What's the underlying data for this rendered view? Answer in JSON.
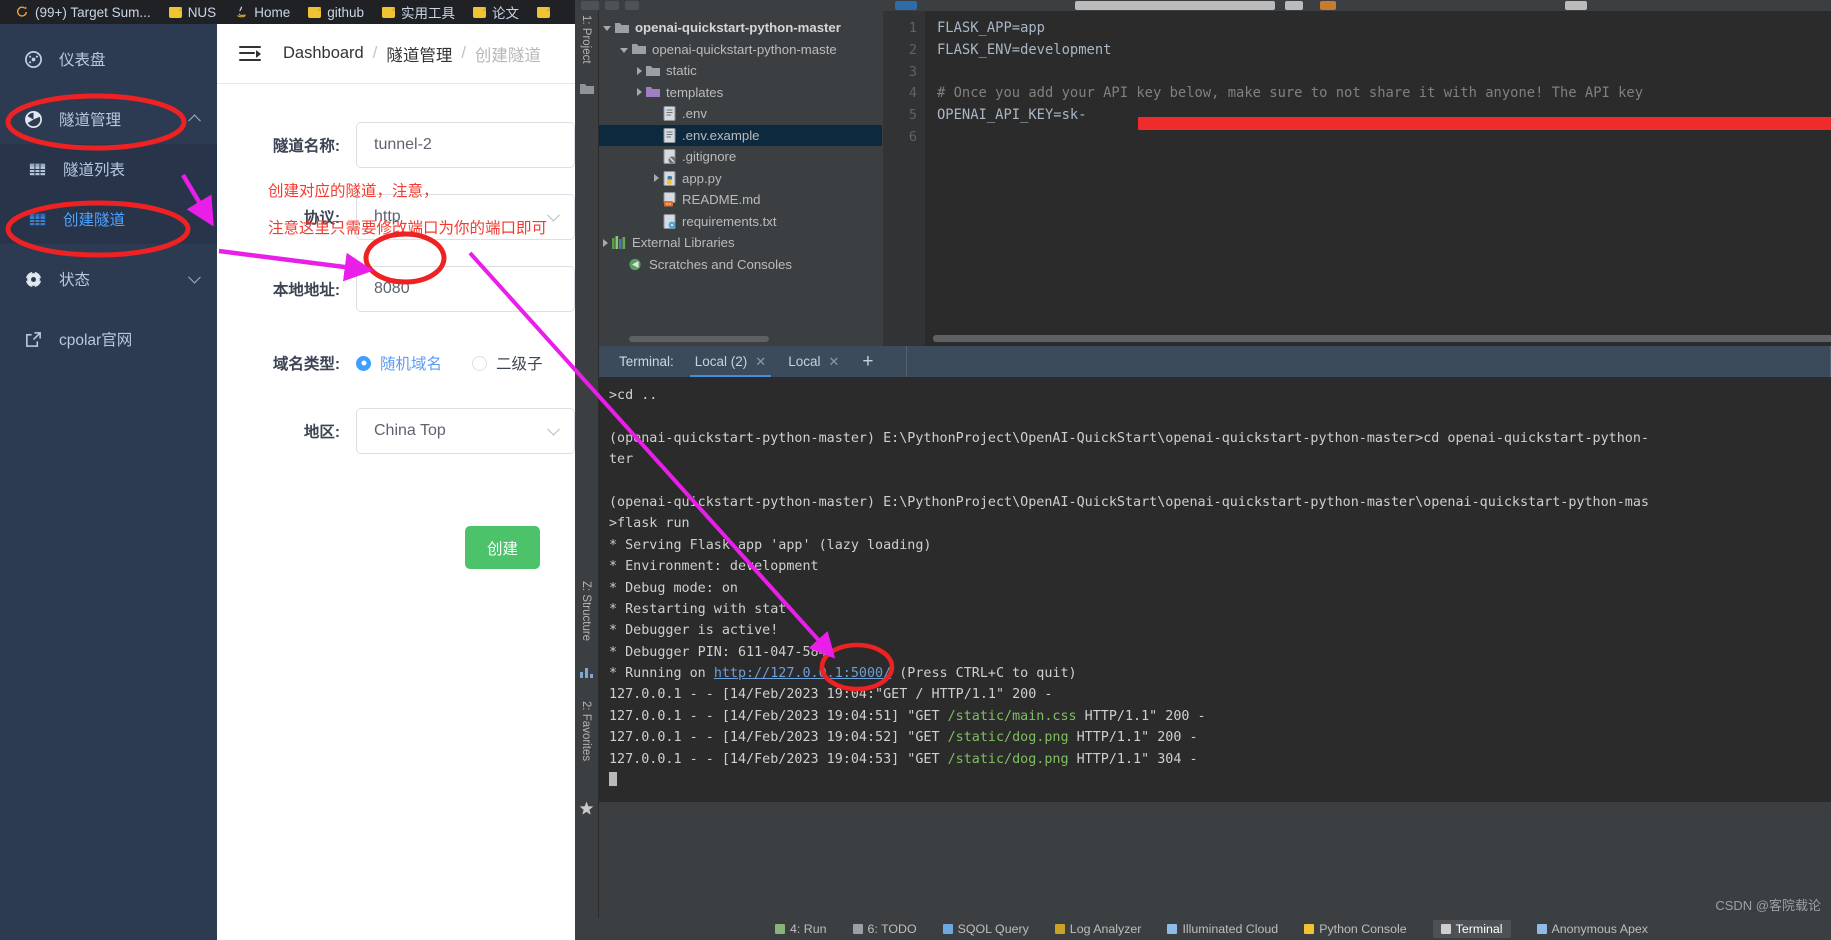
{
  "browser": {
    "bookmarks": [
      {
        "label": "(99+) Target Sum...",
        "icon": "spiral-icon"
      },
      {
        "label": "NUS",
        "icon": "folder-icon"
      },
      {
        "label": "Home",
        "icon": "java-icon"
      },
      {
        "label": "github",
        "icon": "folder-icon"
      },
      {
        "label": "实用工具",
        "icon": "folder-icon"
      },
      {
        "label": "论文",
        "icon": "folder-icon"
      },
      {
        "label": "",
        "icon": "folder-icon"
      }
    ]
  },
  "cpolar": {
    "sidebar": {
      "dashboard": {
        "label": "仪表盘",
        "icon": "gauge-icon"
      },
      "tunnel_mgmt": {
        "label": "隧道管理",
        "icon": "tunnel-icon"
      },
      "tunnel_list": {
        "label": "隧道列表",
        "icon": "grid-icon"
      },
      "create_tunnel": {
        "label": "创建隧道",
        "icon": "grid-blue-icon"
      },
      "status": {
        "label": "状态",
        "icon": "status-icon"
      },
      "website": {
        "label": "cpolar官网",
        "icon": "external-link-icon"
      }
    },
    "breadcrumb": {
      "root": "Dashboard",
      "sep": "/",
      "level1": "隧道管理",
      "level2": "创建隧道"
    },
    "form": {
      "tunnel_name": {
        "label": "隧道名称:",
        "value": "tunnel-2"
      },
      "protocol": {
        "label": "协议:",
        "value": "http"
      },
      "local_addr": {
        "label": "本地地址:",
        "value": "8080"
      },
      "domain_type": {
        "label": "域名类型:",
        "selected": "随机域名",
        "options": [
          "随机域名",
          "二级子"
        ]
      },
      "region": {
        "label": "地区:",
        "value": "China Top"
      },
      "submit": "创建"
    },
    "annotations": {
      "line1": "创建对应的隧道，注意，",
      "line2": "注意这里只需要修改端口为你的端口即可"
    }
  },
  "ide": {
    "left_strips": [
      "1: Project",
      "Z: Structure",
      "2: Favorites"
    ],
    "project_tree": [
      {
        "name": "openai-quickstart-python-master",
        "depth": 0,
        "icon": "folder-icon",
        "arrow": "open",
        "bold": true
      },
      {
        "name": "openai-quickstart-python-maste",
        "depth": 1,
        "icon": "folder-icon",
        "arrow": "open",
        "bold": false
      },
      {
        "name": "static",
        "depth": 2,
        "icon": "folder-icon",
        "arrow": "closed",
        "bold": false
      },
      {
        "name": "templates",
        "depth": 2,
        "icon": "folder-purple-icon",
        "arrow": "closed",
        "bold": false
      },
      {
        "name": ".env",
        "depth": 3,
        "icon": "env-file-icon",
        "arrow": "none",
        "bold": false
      },
      {
        "name": ".env.example",
        "depth": 3,
        "icon": "env-file-icon",
        "arrow": "none",
        "bold": false,
        "selected": true
      },
      {
        "name": ".gitignore",
        "depth": 3,
        "icon": "gitignore-file-icon",
        "arrow": "none",
        "bold": false
      },
      {
        "name": "app.py",
        "depth": 3,
        "icon": "python-file-icon",
        "arrow": "closed",
        "bold": false
      },
      {
        "name": "README.md",
        "depth": 3,
        "icon": "markdown-file-icon",
        "arrow": "none",
        "bold": false
      },
      {
        "name": "requirements.txt",
        "depth": 3,
        "icon": "txt-config-file-icon",
        "arrow": "none",
        "bold": false
      },
      {
        "name": "External Libraries",
        "depth": 0,
        "icon": "libraries-icon",
        "arrow": "closed",
        "bold": false
      },
      {
        "name": "Scratches and Consoles",
        "depth": 1,
        "icon": "scratches-icon",
        "arrow": "none",
        "bold": false
      }
    ],
    "editor": {
      "line_numbers": [
        "1",
        "2",
        "3",
        "4",
        "5",
        "6"
      ],
      "lines": [
        "FLASK_APP=app",
        "FLASK_ENV=development",
        "",
        "# Once you add your API key below, make sure to not share it with anyone! The API key",
        "OPENAI_API_KEY=sk-",
        ""
      ]
    },
    "terminal": {
      "label": "Terminal:",
      "tabs": [
        {
          "label": "Local (2)",
          "active": true
        },
        {
          "label": "Local",
          "active": false
        }
      ],
      "add": "+",
      "lines": [
        ">cd ..",
        "",
        "(openai-quickstart-python-master) E:\\PythonProject\\OpenAI-QuickStart\\openai-quickstart-python-master>cd openai-quickstart-python-",
        "ter",
        "",
        "(openai-quickstart-python-master) E:\\PythonProject\\OpenAI-QuickStart\\openai-quickstart-python-master\\openai-quickstart-python-mas",
        ">flask run",
        " * Serving Flask app 'app' (lazy loading)",
        " * Environment: development",
        " * Debug mode: on",
        " * Restarting with stat",
        " * Debugger is active!",
        " * Debugger PIN: 611-047-584"
      ],
      "running_line": {
        "prefix": " * Running on ",
        "url": "http://127.0.0.1:5000/",
        "suffix": " (Press CTRL+C to quit)"
      },
      "access_logs": [
        {
          "head": "127.0.0.1 - - [14/Feb/2023 19:04:",
          "path": "",
          "tail": "\"GET / HTTP/1.1\" 200 -"
        },
        {
          "head": "127.0.0.1 - - [14/Feb/2023 19:04:51] \"GET ",
          "path": "/static/main.css",
          "tail": " HTTP/1.1\" 200 -"
        },
        {
          "head": "127.0.0.1 - - [14/Feb/2023 19:04:52] \"GET ",
          "path": "/static/dog.png",
          "tail": " HTTP/1.1\" 200 -"
        },
        {
          "head": "127.0.0.1 - - [14/Feb/2023 19:04:53] \"GET ",
          "path": "/static/dog.png",
          "tail": " HTTP/1.1\" 304 -"
        }
      ]
    },
    "bottom_bar": [
      {
        "label": "4: Run",
        "selected": false,
        "icon": "run-icon"
      },
      {
        "label": "6: TODO",
        "selected": false,
        "icon": "todo-icon"
      },
      {
        "label": "SQOL Query",
        "selected": false,
        "icon": "sql-icon"
      },
      {
        "label": "Log Analyzer",
        "selected": false,
        "icon": "log-icon"
      },
      {
        "label": "Illuminated Cloud",
        "selected": false,
        "icon": "cloud-icon"
      },
      {
        "label": "Python Console",
        "selected": false,
        "icon": "console-icon"
      },
      {
        "label": "Terminal",
        "selected": true,
        "icon": "terminal-icon"
      },
      {
        "label": "Anonymous Apex",
        "selected": false,
        "icon": "apex-icon"
      }
    ]
  },
  "watermark": "CSDN @客院载论",
  "colors": {
    "annotation_red": "#f5392e",
    "annotation_magenta": "#e91ee9",
    "sidebar_bg": "#2c3b52",
    "accent_blue": "#409eff",
    "create_green": "#4cc26a"
  }
}
